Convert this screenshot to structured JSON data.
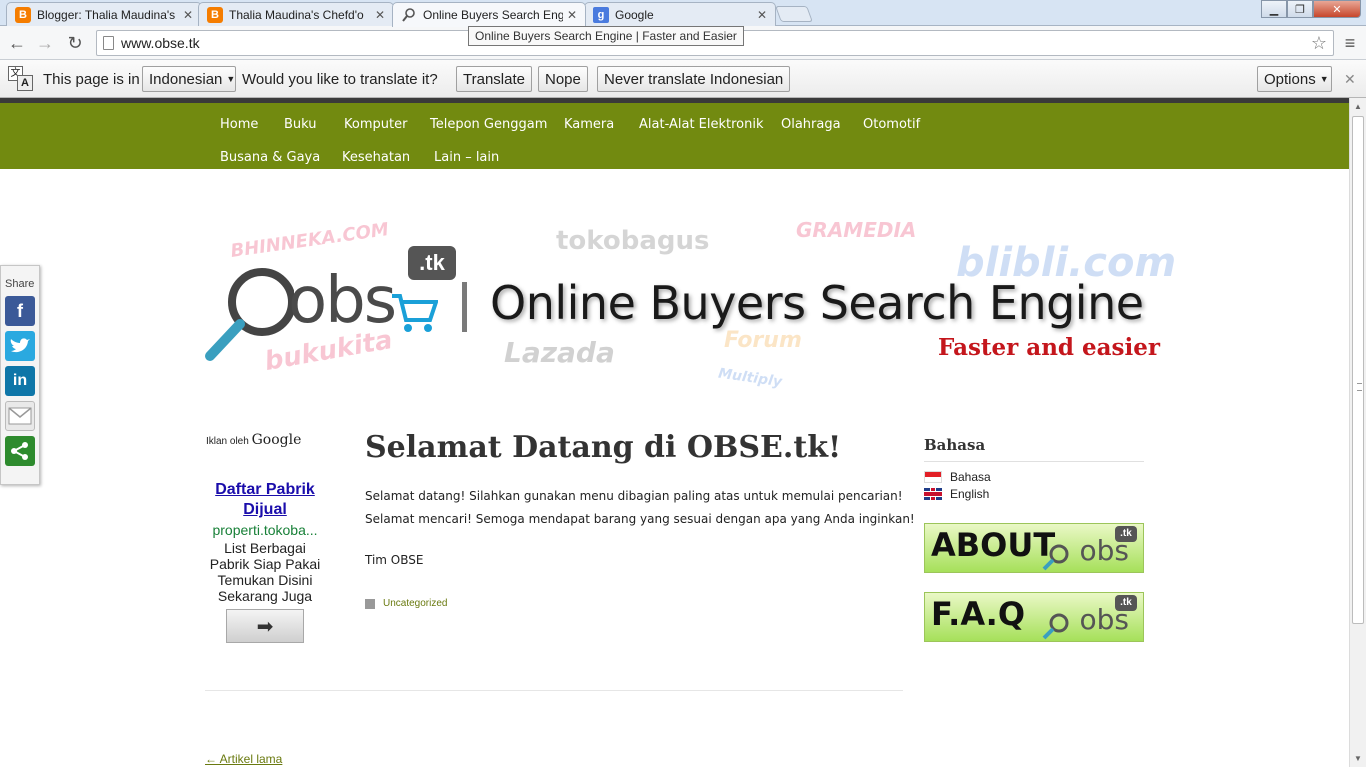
{
  "tabs": [
    {
      "title": "Blogger: Thalia Maudina's",
      "icon": "blogger-icon"
    },
    {
      "title": "Thalia Maudina's Chefd'o",
      "icon": "blogger-icon"
    },
    {
      "title": "Online Buyers Search Engi",
      "icon": "search-icon"
    },
    {
      "title": "Google",
      "icon": "google-icon"
    }
  ],
  "address": {
    "url": "www.obse.tk"
  },
  "tooltip": "Online Buyers Search Engine | Faster and Easier",
  "translate_bar": {
    "prefix": "This page is in",
    "language": "Indonesian",
    "question": "Would you like to translate it?",
    "translate": "Translate",
    "nope": "Nope",
    "never": "Never translate Indonesian",
    "options": "Options"
  },
  "menu": {
    "row1": [
      "Home",
      "Buku",
      "Komputer",
      "Telepon Genggam",
      "Kamera",
      "Alat-Alat Elektronik",
      "Olahraga",
      "Otomotif"
    ],
    "row2": [
      "Busana & Gaya",
      "Kesehatan",
      "Lain – lain"
    ]
  },
  "banner": {
    "logo_text": "obs",
    "logo_tk": ".tk",
    "title": "Online Buyers Search Engine",
    "subtitle": "Faster and easier",
    "watermarks": [
      "BHINNEKA.COM",
      "tokobagus",
      "GRAMEDIA",
      "blibli.com",
      "bukukita",
      "Lazada",
      "Forum",
      "Multiply"
    ]
  },
  "share": {
    "label": "Share"
  },
  "ads": {
    "ads_by": "Iklan oleh",
    "ads_brand": "Google",
    "title": "Daftar Pabrik Dijual",
    "url": "properti.tokoba...",
    "text": "List Berbagai Pabrik Siap Pakai Temukan Disini Sekarang Juga",
    "arrow": "➡"
  },
  "post": {
    "title": "Selamat Datang di OBSE.tk!",
    "line1": "Selamat datang! Silahkan gunakan menu dibagian paling atas untuk memulai pencarian!",
    "line2": "Selamat mencari! Semoga mendapat barang yang sesuai dengan apa yang Anda inginkan!",
    "signature": "Tim OBSE",
    "category": "Uncategorized",
    "older": "← Artikel lama"
  },
  "sidebar": {
    "widget_title": "Bahasa",
    "languages": [
      "Bahasa",
      "English"
    ],
    "about": "ABOUT",
    "faq": "F.A.Q",
    "banner_logo": "obs",
    "banner_tk": ".tk"
  }
}
